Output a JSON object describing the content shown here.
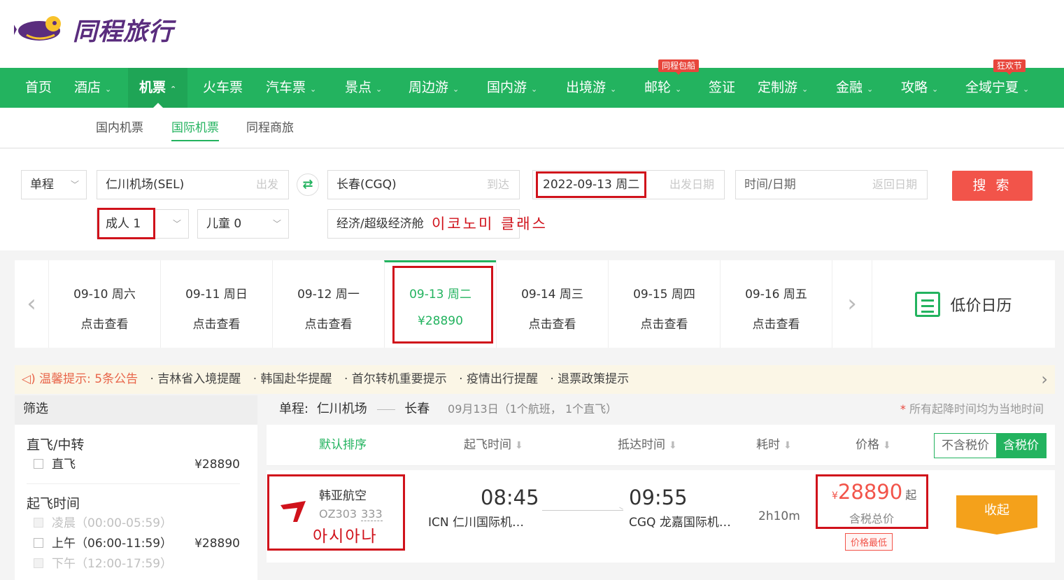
{
  "brand": {
    "name": "同程旅行"
  },
  "nav": {
    "items": [
      {
        "label": "首页"
      },
      {
        "label": "酒店"
      },
      {
        "label": "机票"
      },
      {
        "label": "火车票"
      },
      {
        "label": "汽车票"
      },
      {
        "label": "景点"
      },
      {
        "label": "周边游"
      },
      {
        "label": "国内游"
      },
      {
        "label": "出境游"
      },
      {
        "label": "邮轮",
        "badge": "同程包船"
      },
      {
        "label": "签证"
      },
      {
        "label": "定制游"
      },
      {
        "label": "金融"
      },
      {
        "label": "攻略"
      },
      {
        "label": "全域宁夏",
        "badge": "狂欢节"
      }
    ]
  },
  "subnav": {
    "items": [
      {
        "label": "国内机票"
      },
      {
        "label": "国际机票"
      },
      {
        "label": "同程商旅"
      }
    ]
  },
  "search": {
    "trip_type": "单程",
    "from": "仁川机场(SEL)",
    "from_hint": "出发",
    "to": "长春(CGQ)",
    "to_hint": "到达",
    "depart_date": "2022-09-13 周二",
    "depart_hint": "出发日期",
    "return_placeholder": "时间/日期",
    "return_hint": "返回日期",
    "search_label": "搜 索",
    "adults": "成人 1",
    "children": "儿童 0",
    "cabin": "经济/超级经济舱",
    "cabin_annotation": "이코노미 클래스"
  },
  "dates": [
    {
      "date": "09-10 周六",
      "price": "点击查看"
    },
    {
      "date": "09-11 周日",
      "price": "点击查看"
    },
    {
      "date": "09-12 周一",
      "price": "点击查看"
    },
    {
      "date": "09-13 周二",
      "price": "¥28890"
    },
    {
      "date": "09-14 周三",
      "price": "点击查看"
    },
    {
      "date": "09-15 周四",
      "price": "点击查看"
    },
    {
      "date": "09-16 周五",
      "price": "点击查看"
    }
  ],
  "low_price_calendar": "低价日历",
  "notice": {
    "label": "温馨提示:",
    "count": "5条公告",
    "items": [
      "· 吉林省入境提醒",
      "· 韩国赴华提醒",
      "· 首尔转机重要提示",
      "· 疫情出行提醒",
      "· 退票政策提示"
    ]
  },
  "filter": {
    "header": "筛选",
    "groups": {
      "direct": {
        "title": "直飞/中转",
        "option": "直飞",
        "price": "¥28890"
      },
      "depart_time": {
        "title": "起飞时间",
        "options": [
          {
            "label": "凌晨（00:00-05:59）",
            "price": ""
          },
          {
            "label": "上午（06:00-11:59）",
            "price": "¥28890"
          },
          {
            "label": "下午（12:00-17:59）",
            "price": ""
          }
        ]
      }
    }
  },
  "route": {
    "prefix": "单程:",
    "from": "仁川机场",
    "to": "长春",
    "meta": "09月13日（1个航班， 1个直飞）",
    "local_note_star": "*",
    "local_note": "所有起降时间均为当地时间"
  },
  "sort": {
    "default": "默认排序",
    "depart": "起飞时间",
    "arrive": "抵达时间",
    "duration": "耗时",
    "price": "价格",
    "excl_tax": "不含税价",
    "incl_tax": "含税价"
  },
  "flight": {
    "airline": "韩亚航空",
    "flight_no": "OZ303",
    "share_code": "333",
    "airline_annotation": "아시아나",
    "depart_time": "08:45",
    "depart_airport": "ICN 仁川国际机…",
    "arrive_time": "09:55",
    "arrive_airport": "CGQ 龙嘉国际机…",
    "duration": "2h10m",
    "currency": "¥",
    "price": "28890",
    "price_suffix": "起",
    "price_note": "含税总价",
    "tag": "价格最低",
    "action": "收起"
  },
  "colors": {
    "brand_green": "#23b35f",
    "highlight_red": "#d0121b",
    "price_red": "#f2544a",
    "action_orange": "#f4a11b"
  }
}
